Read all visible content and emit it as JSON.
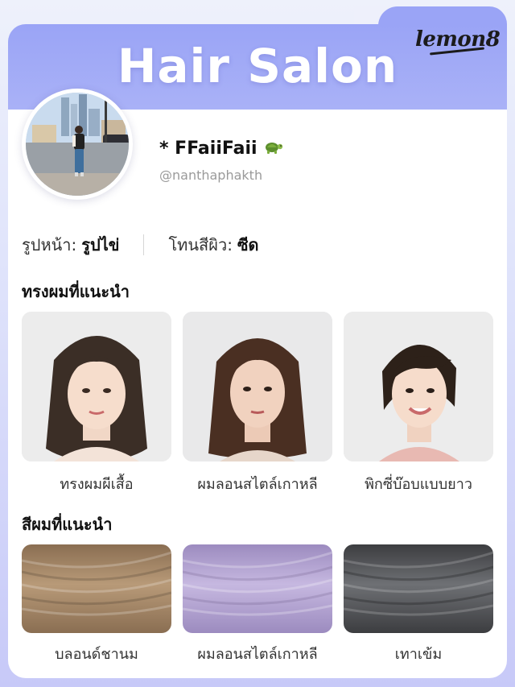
{
  "header": {
    "title": "Hair Salon",
    "brand": "lemon8"
  },
  "profile": {
    "name": "* FFaiiFaii",
    "handle": "@nanthaphakth",
    "name_icon": "turtle-icon"
  },
  "attributes": [
    {
      "label": "รูปหน้า:",
      "value": "รูปไข่"
    },
    {
      "label": "โทนสีผิว:",
      "value": "ซีด"
    }
  ],
  "hairstyles": {
    "title": "ทรงผมที่แนะนำ",
    "items": [
      {
        "label": "ทรงผมผีเสื้อ",
        "hair_color": "#3b2e26"
      },
      {
        "label": "ผมลอนสไตล์เกาหลี",
        "hair_color": "#4a2f22"
      },
      {
        "label": "พิกซี่บ๊อบแบบยาว",
        "hair_color": "#2d2119"
      }
    ]
  },
  "hair_colors": {
    "title": "สีผมที่แนะนำ",
    "items": [
      {
        "label": "บลอนด์ชานม",
        "color": "#8a6e52",
        "highlight": "#b89a78"
      },
      {
        "label": "ผมลอนสไตล์เกาหลี",
        "color": "#9c8bbf",
        "highlight": "#c6b8e0"
      },
      {
        "label": "เทาเข้ม",
        "color": "#3c3d40",
        "highlight": "#6e7074"
      }
    ]
  }
}
